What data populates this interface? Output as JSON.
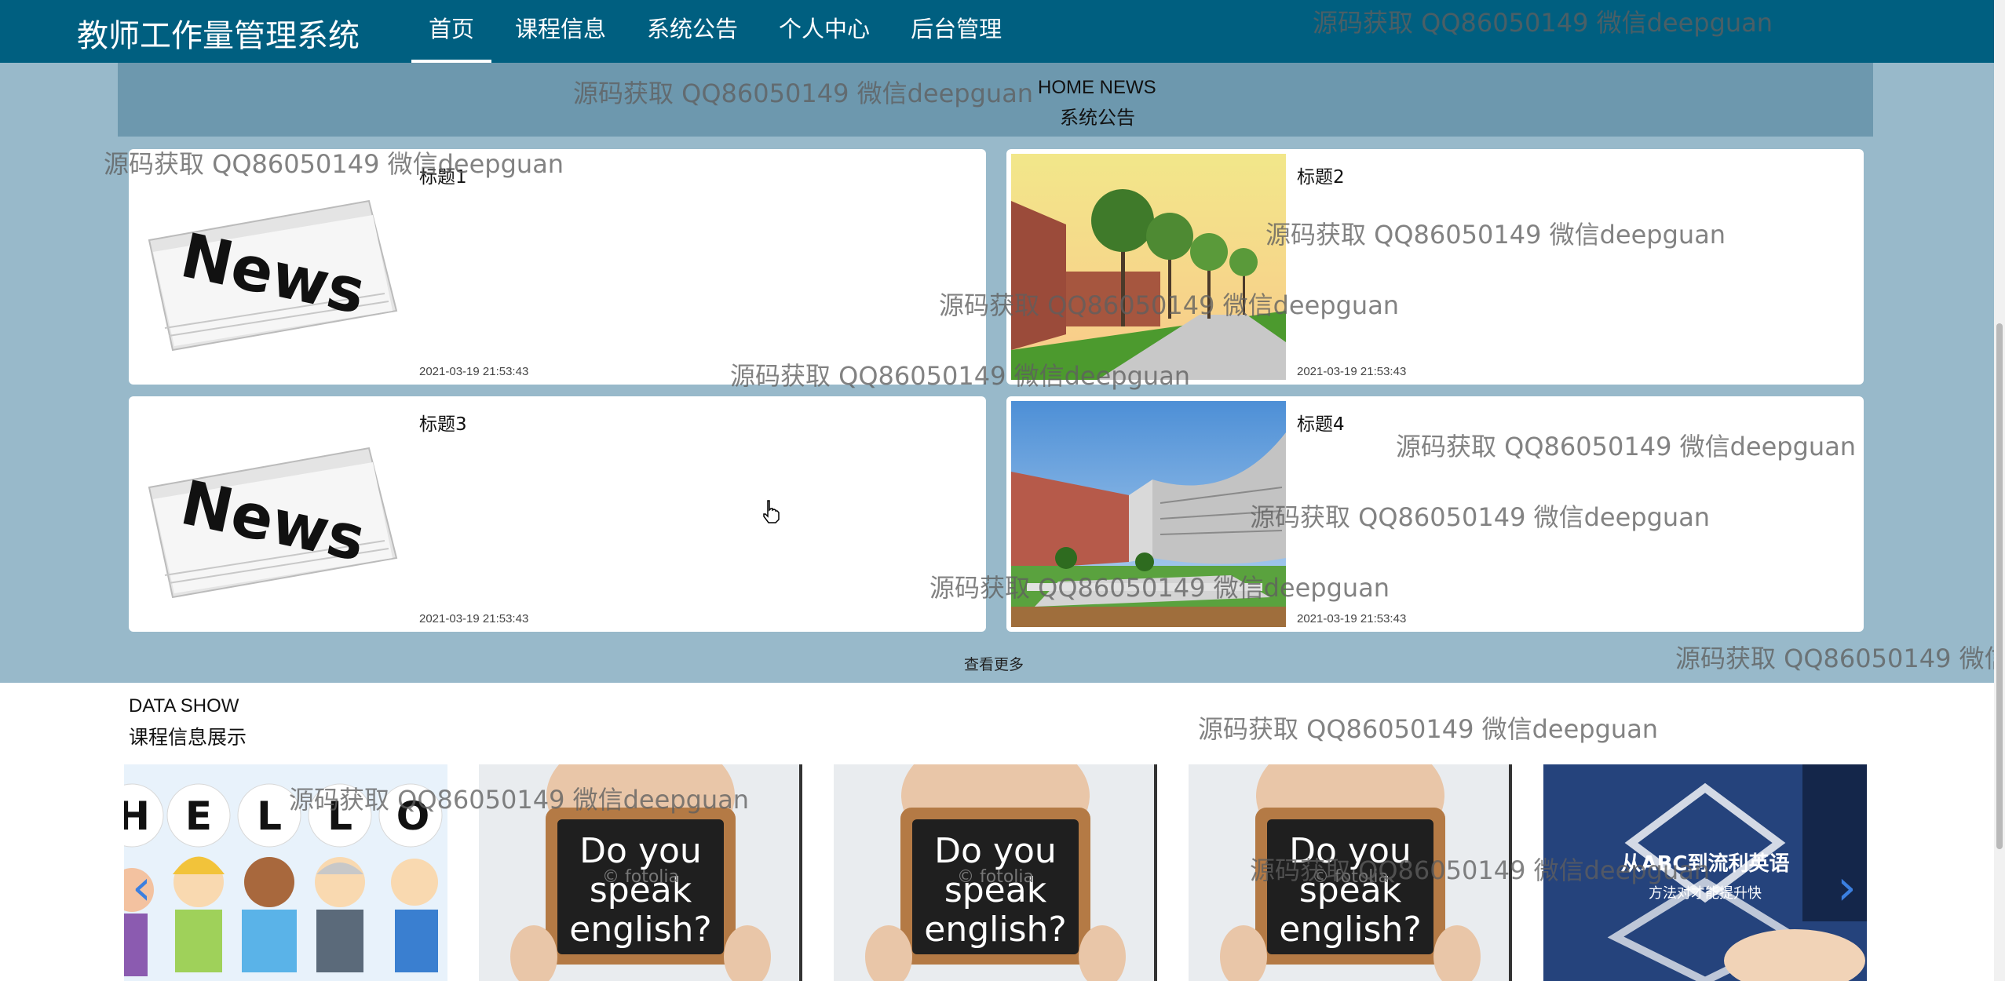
{
  "header": {
    "brand": "教师工作量管理系统",
    "nav": [
      {
        "label": "首页",
        "active": true
      },
      {
        "label": "课程信息",
        "active": false
      },
      {
        "label": "系统公告",
        "active": false
      },
      {
        "label": "个人中心",
        "active": false
      },
      {
        "label": "后台管理",
        "active": false
      }
    ]
  },
  "news": {
    "heading_en": "HOME NEWS",
    "heading_cn": "系统公告",
    "items": [
      {
        "title": "标题1",
        "time": "2021-03-19 21:53:43",
        "image": "newspaper"
      },
      {
        "title": "标题2",
        "time": "2021-03-19 21:53:43",
        "image": "campus-trees"
      },
      {
        "title": "标题3",
        "time": "2021-03-19 21:53:43",
        "image": "newspaper"
      },
      {
        "title": "标题4",
        "time": "2021-03-19 21:53:43",
        "image": "campus-building"
      }
    ],
    "more_label": "查看更多"
  },
  "datashow": {
    "heading_en": "DATA SHOW",
    "heading_cn": "课程信息展示",
    "slides": [
      {
        "image": "hello-cartoon",
        "text": "HELLO"
      },
      {
        "image": "speak-english",
        "text": "Do you speak english?"
      },
      {
        "image": "speak-english",
        "text": "Do you speak english?"
      },
      {
        "image": "speak-english",
        "text": "Do you speak english?"
      },
      {
        "image": "abc-english",
        "text": "从ABC到流利英语 方法对才能提升快"
      }
    ],
    "prev_icon": "‹",
    "next_icon": "›"
  },
  "image_text": {
    "news_word": "News",
    "watermark_small": "© fotolia"
  },
  "watermark": "源码获取 QQ86050149 微信deepguan",
  "colors": {
    "nav_bg": "#005f80",
    "section_bg": "#98b9ca",
    "header_band": "#6d98ae",
    "arrow": "#3b7fe0"
  }
}
